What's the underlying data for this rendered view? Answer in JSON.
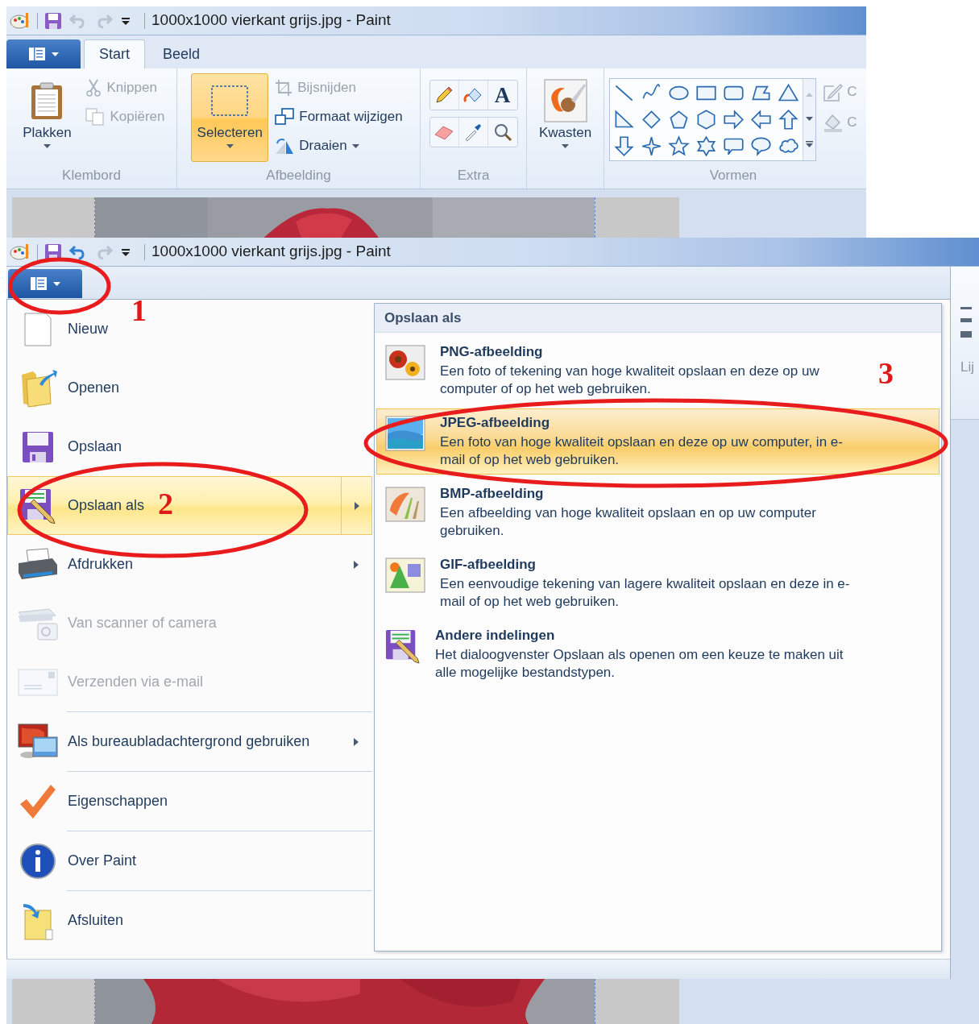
{
  "back_window": {
    "title": "1000x1000 vierkant grijs.jpg - Paint",
    "quick_access": {
      "undo_disabled": true,
      "redo_disabled": true
    },
    "tabs": [
      {
        "label": "Start",
        "selected": true
      },
      {
        "label": "Beeld",
        "selected": false
      }
    ],
    "ribbon": {
      "groups": [
        {
          "kind": "buttons",
          "label": "Klembord",
          "large": {
            "label": "Plakken",
            "selected": false,
            "dropdown": true
          },
          "small": [
            {
              "label": "Knippen",
              "disabled": true,
              "dropdown": false
            },
            {
              "label": "Kopiëren",
              "disabled": true,
              "dropdown": false
            }
          ]
        },
        {
          "kind": "buttons",
          "label": "Afbeelding",
          "large": {
            "label": "Selecteren",
            "selected": true,
            "dropdown": true
          },
          "small": [
            {
              "label": "Bijsnijden",
              "disabled": true,
              "dropdown": false
            },
            {
              "label": "Formaat wijzigen",
              "disabled": false,
              "dropdown": false
            },
            {
              "label": "Draaien",
              "disabled": false,
              "dropdown": true
            }
          ]
        },
        {
          "kind": "tools",
          "label": "Extra",
          "text_tool": "A"
        },
        {
          "kind": "buttons",
          "large": {
            "label": "Kwasten",
            "selected": false,
            "dropdown": true
          }
        },
        {
          "kind": "shapes",
          "label": "Vormen",
          "cut_labels": [
            "C",
            "C"
          ]
        }
      ]
    }
  },
  "front_window": {
    "title": "1000x1000 vierkant grijs.jpg - Paint",
    "quick_access": {
      "undo_disabled": false,
      "redo_disabled": true
    },
    "menu": {
      "items": [
        {
          "label": "Nieuw",
          "selected": false,
          "disabled": false,
          "submenu": false,
          "divider": false
        },
        {
          "label": "Openen",
          "selected": false,
          "disabled": false,
          "submenu": false,
          "divider": false
        },
        {
          "label": "Opslaan",
          "selected": false,
          "disabled": false,
          "submenu": false,
          "divider": false
        },
        {
          "label": "Opslaan als",
          "selected": true,
          "disabled": false,
          "submenu": true,
          "divider": false
        },
        {
          "label": "Afdrukken",
          "selected": false,
          "disabled": false,
          "submenu": true,
          "divider": false
        },
        {
          "label": "Van scanner of camera",
          "selected": false,
          "disabled": true,
          "submenu": false,
          "divider": false
        },
        {
          "label": "Verzenden via e-mail",
          "selected": false,
          "disabled": true,
          "submenu": false,
          "divider": false
        },
        {
          "label": "Als bureaubladachtergrond gebruiken",
          "selected": false,
          "disabled": false,
          "submenu": true,
          "divider": true
        },
        {
          "label": "Eigenschappen",
          "selected": false,
          "disabled": false,
          "submenu": false,
          "divider": true
        },
        {
          "label": "Over Paint",
          "selected": false,
          "disabled": false,
          "submenu": false,
          "divider": true
        },
        {
          "label": "Afsluiten",
          "selected": false,
          "disabled": false,
          "submenu": false,
          "divider": true
        }
      ],
      "panel": {
        "title": "Opslaan als",
        "options": [
          {
            "title": "PNG-afbeelding",
            "description": "Een foto of tekening van hoge kwaliteit opslaan en deze op uw computer of op het web gebruiken.",
            "selected": false
          },
          {
            "title": "JPEG-afbeelding",
            "description": "Een foto van hoge kwaliteit opslaan en deze op uw computer, in e-mail of op het web gebruiken.",
            "selected": true
          },
          {
            "title": "BMP-afbeelding",
            "description": "Een afbeelding van hoge kwaliteit opslaan en op uw computer gebruiken.",
            "selected": false
          },
          {
            "title": "GIF-afbeelding",
            "description": "Een eenvoudige tekening van lagere kwaliteit opslaan en deze in e-mail of op het web gebruiken.",
            "selected": false
          },
          {
            "title": "Andere indelingen",
            "description": "Het dialoogvenster Opslaan als openen om een keuze te maken uit alle mogelijke bestandstypen.",
            "selected": false
          }
        ]
      }
    },
    "ribbon_remnant": {
      "label": "Lij"
    }
  },
  "annotations": [
    {
      "label": "1"
    },
    {
      "label": "2"
    },
    {
      "label": "3"
    }
  ]
}
